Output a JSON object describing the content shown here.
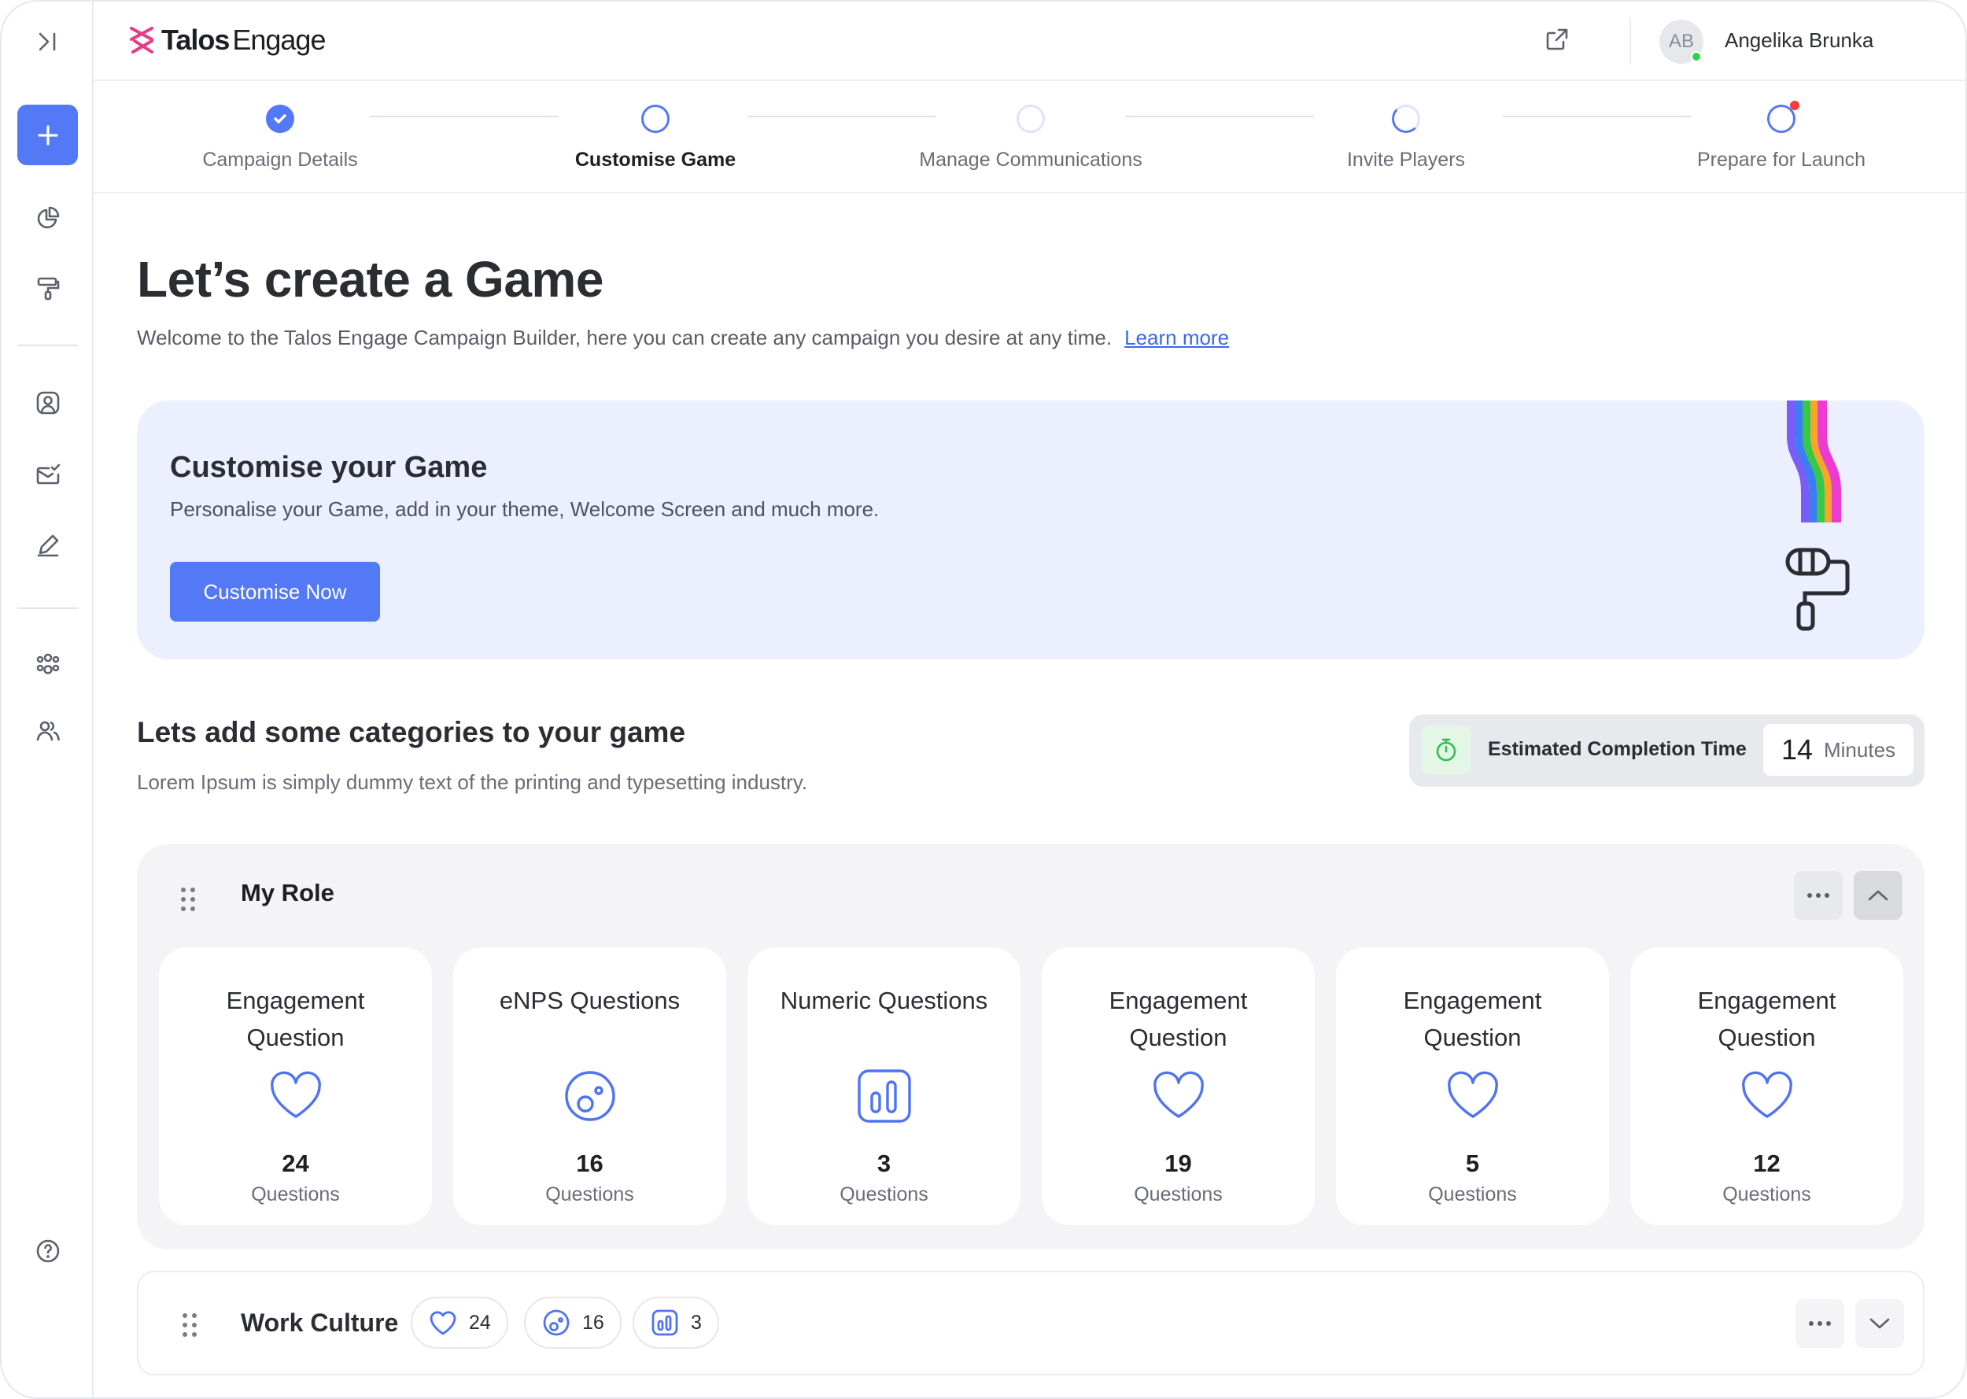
{
  "app": {
    "logo_bold": "Talos",
    "logo_normal": "Engage",
    "user": {
      "initials": "AB",
      "name": "Angelika Brunka",
      "status_color": "#2fd24e"
    },
    "accent_color": "#5479f7"
  },
  "sidebar": {
    "items": [
      {
        "icon": "collapse-sidebar-icon"
      },
      {
        "icon": "plus-icon"
      },
      {
        "icon": "pie-chart-icon"
      },
      {
        "icon": "paint-roller-icon"
      },
      {
        "icon": "user-square-icon"
      },
      {
        "icon": "mail-check-icon"
      },
      {
        "icon": "pen-icon"
      },
      {
        "icon": "group-icon"
      },
      {
        "icon": "users-icon"
      },
      {
        "icon": "help-icon"
      }
    ]
  },
  "stepper": {
    "steps": [
      {
        "label": "Campaign Details",
        "state": "done"
      },
      {
        "label": "Customise Game",
        "state": "active"
      },
      {
        "label": "Manage Communications",
        "state": "pending"
      },
      {
        "label": "Invite Players",
        "state": "partial"
      },
      {
        "label": "Prepare for Launch",
        "state": "alert"
      }
    ]
  },
  "main": {
    "title": "Let’s create a Game",
    "lead": "Welcome to the Talos Engage Campaign Builder, here you can create any campaign you desire at any time.",
    "learn_more": "Learn more",
    "banner": {
      "title": "Customise your Game",
      "subtitle": "Personalise your Game, add in your theme, Welcome Screen and much more.",
      "button": "Customise Now"
    },
    "categories": {
      "title": "Lets add some categories to your game",
      "subtitle": "Lorem Ipsum is simply dummy text of the printing and typesetting industry.",
      "estimate_label": "Estimated Completion Time",
      "estimate_value": "14",
      "estimate_unit": "Minutes"
    },
    "panels": [
      {
        "title": "My Role",
        "cards": [
          {
            "title": "Engagement Question",
            "icon": "heart-icon",
            "count": "24",
            "unit": "Questions"
          },
          {
            "title": "eNPS Questions",
            "icon": "enps-icon",
            "count": "16",
            "unit": "Questions"
          },
          {
            "title": "Numeric Questions",
            "icon": "bar-chart-icon",
            "count": "3",
            "unit": "Questions"
          },
          {
            "title": "Engagement Question",
            "icon": "heart-icon",
            "count": "19",
            "unit": "Questions"
          },
          {
            "title": "Engagement Question",
            "icon": "heart-icon",
            "count": "5",
            "unit": "Questions"
          },
          {
            "title": "Engagement Question",
            "icon": "heart-icon",
            "count": "12",
            "unit": "Questions"
          }
        ]
      },
      {
        "title": "Work Culture",
        "pills": [
          {
            "icon": "heart-icon",
            "count": "24"
          },
          {
            "icon": "enps-icon",
            "count": "16"
          },
          {
            "icon": "bar-chart-icon",
            "count": "3"
          }
        ]
      }
    ]
  }
}
